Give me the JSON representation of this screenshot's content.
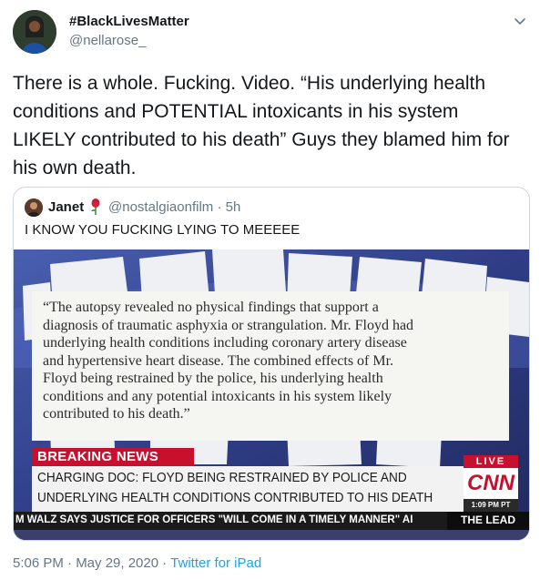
{
  "tweet": {
    "display_name": "#BlackLivesMatter",
    "handle": "@nellarose_",
    "text": "There is a whole. Fucking. Video. “His underlying health conditions and POTENTIAL intoxicants in his system LIKELY contributed to his death” Guys they blamed him for his own death.",
    "timestamp": "5:06 PM · May 29, 2020",
    "separator": " · ",
    "source": "Twitter for iPad"
  },
  "quoted": {
    "display_name": "Janet",
    "handle": "@nostalgiaonfilm",
    "time": "5h",
    "separator": " · ",
    "text": "I KNOW YOU FUCKING LYING TO MEEEEE"
  },
  "media": {
    "quote_lines": [
      "“The autopsy revealed no physical findings that support a",
      "diagnosis of traumatic asphyxia or strangulation. Mr. Floyd had",
      "underlying health conditions including coronary artery disease",
      "and hypertensive heart disease. The combined effects of Mr.",
      "Floyd being restrained by the police, his underlying health",
      "conditions and any potential intoxicants in his system likely",
      "contributed to his death.”"
    ],
    "breaking": "BREAKING NEWS",
    "headline_1": "CHARGING DOC: FLOYD BEING RESTRAINED BY POLICE AND",
    "headline_2": "UNDERLYING HEALTH CONDITIONS CONTRIBUTED TO HIS DEATH",
    "live": "LIVE",
    "network": "CNN",
    "clock": "1:09 PM PT",
    "ticker": "M WALZ SAYS JUSTICE FOR OFFICERS \"WILL COME IN A TIMELY MANNER\" AI",
    "show": "THE LEAD"
  },
  "icons": {
    "menu": "chevron-down-icon",
    "emoji": "rose-emoji-icon"
  },
  "colors": {
    "breaking_red": "#c8102e",
    "link_blue": "#1da1f2",
    "muted": "#657786"
  }
}
